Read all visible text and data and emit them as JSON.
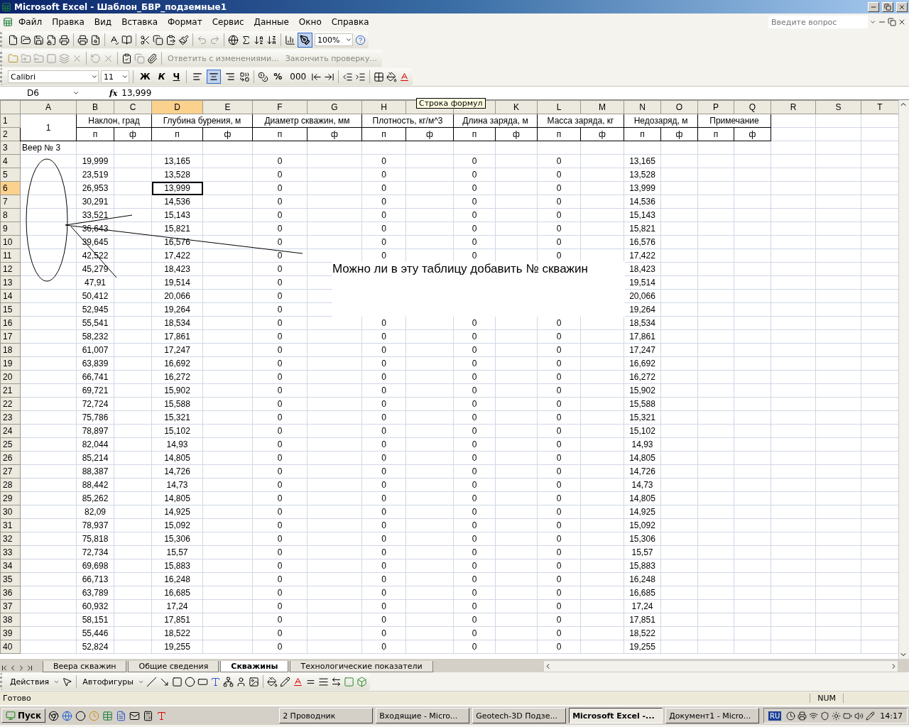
{
  "window": {
    "title": "Microsoft Excel - Шаблон_БВР_подземные1"
  },
  "menu": [
    "Файл",
    "Правка",
    "Вид",
    "Вставка",
    "Формат",
    "Сервис",
    "Данные",
    "Окно",
    "Справка"
  ],
  "help_search": {
    "placeholder": "Введите вопрос"
  },
  "standard_toolbar": {
    "zoom": "100%",
    "drawing_pressed": true
  },
  "review_toolbar": {
    "reply": "Ответить с изменениями...",
    "end_review": "Закончить проверку..."
  },
  "formatting_toolbar": {
    "font": "Calibri",
    "size": "11",
    "bold": "Ж",
    "italic": "К",
    "underline": "Ч",
    "alignment": [
      {
        "selected": false
      },
      {
        "selected": true
      },
      {
        "selected": false
      }
    ],
    "percent": "%",
    "thousands": "000"
  },
  "formula_bar": {
    "name_box": "D6",
    "fx": "fx",
    "value": "13,999"
  },
  "tooltip": "Строка формул",
  "columns": [
    {
      "label": "A",
      "selected": false
    },
    {
      "label": "B",
      "selected": false
    },
    {
      "label": "C",
      "selected": false
    },
    {
      "label": "D",
      "selected": true
    },
    {
      "label": "E",
      "selected": false
    },
    {
      "label": "F",
      "selected": false
    },
    {
      "label": "G",
      "selected": false
    },
    {
      "label": "H",
      "selected": false
    },
    {
      "selected": false
    },
    {
      "selected": false
    },
    {
      "label": "K",
      "selected": false
    },
    {
      "label": "L",
      "selected": false
    },
    {
      "label": "M",
      "selected": false
    },
    {
      "label": "N",
      "selected": false
    },
    {
      "label": "O",
      "selected": false
    },
    {
      "label": "P",
      "selected": false
    },
    {
      "label": "Q",
      "selected": false
    },
    {
      "label": "R",
      "selected": false
    },
    {
      "label": "S",
      "selected": false
    },
    {
      "label": "T",
      "selected": false
    }
  ],
  "header_row1": {
    "num": "1",
    "a": "1",
    "groups": [
      "Наклон, град",
      "Глубина бурения, м",
      "Диаметр скважин, мм",
      "Плотность, кг/м^3",
      "Длина заряда, м",
      "Масса заряда, кг",
      "Недозаряд, м",
      "Примечание"
    ]
  },
  "header_row2": {
    "num": "2",
    "labels": [
      "п",
      "ф",
      "п",
      "ф",
      "п",
      "ф",
      "п",
      "ф",
      "п",
      "ф",
      "п",
      "ф",
      "п",
      "ф",
      "п",
      "ф"
    ]
  },
  "row3": {
    "num": "3",
    "a": "Веер № 3"
  },
  "rows": [
    {
      "num": "4",
      "selected": false,
      "b": "19,999",
      "d": "13,165",
      "f": "0",
      "h": "0",
      "j": "0",
      "l": "0",
      "n": "13,165"
    },
    {
      "num": "5",
      "selected": false,
      "b": "23,519",
      "d": "13,528",
      "f": "0",
      "h": "0",
      "j": "0",
      "l": "0",
      "n": "13,528"
    },
    {
      "num": "6",
      "selected": true,
      "b": "26,953",
      "d": "13,999",
      "f": "0",
      "h": "0",
      "j": "0",
      "l": "0",
      "n": "13,999"
    },
    {
      "num": "7",
      "selected": false,
      "b": "30,291",
      "d": "14,536",
      "f": "0",
      "h": "0",
      "j": "0",
      "l": "0",
      "n": "14,536"
    },
    {
      "num": "8",
      "selected": false,
      "b": "33,521",
      "d": "15,143",
      "f": "0",
      "h": "0",
      "j": "0",
      "l": "0",
      "n": "15,143"
    },
    {
      "num": "9",
      "selected": false,
      "b": "36,643",
      "d": "15,821",
      "f": "0",
      "h": "0",
      "j": "0",
      "l": "0",
      "n": "15,821"
    },
    {
      "num": "10",
      "selected": false,
      "b": "39,645",
      "d": "16,576",
      "f": "0",
      "h": "0",
      "j": "0",
      "l": "0",
      "n": "16,576"
    },
    {
      "num": "11",
      "selected": false,
      "b": "42,522",
      "d": "17,422",
      "f": "0",
      "h": "0",
      "j": "0",
      "l": "0",
      "n": "17,422"
    },
    {
      "num": "12",
      "selected": false,
      "b": "45,279",
      "d": "18,423",
      "f": "0",
      "n": "18,423"
    },
    {
      "num": "13",
      "selected": false,
      "b": "47,91",
      "d": "19,514",
      "f": "0",
      "n": "19,514"
    },
    {
      "num": "14",
      "selected": false,
      "b": "50,412",
      "d": "20,066",
      "f": "0",
      "n": "20,066"
    },
    {
      "num": "15",
      "selected": false,
      "b": "52,945",
      "d": "19,264",
      "f": "0",
      "n": "19,264"
    },
    {
      "num": "16",
      "selected": false,
      "b": "55,541",
      "d": "18,534",
      "f": "0",
      "h": "0",
      "j": "0",
      "l": "0",
      "n": "18,534"
    },
    {
      "num": "17",
      "selected": false,
      "b": "58,232",
      "d": "17,861",
      "f": "0",
      "h": "0",
      "j": "0",
      "l": "0",
      "n": "17,861"
    },
    {
      "num": "18",
      "selected": false,
      "b": "61,007",
      "d": "17,247",
      "f": "0",
      "h": "0",
      "j": "0",
      "l": "0",
      "n": "17,247"
    },
    {
      "num": "19",
      "selected": false,
      "b": "63,839",
      "d": "16,692",
      "f": "0",
      "h": "0",
      "j": "0",
      "l": "0",
      "n": "16,692"
    },
    {
      "num": "20",
      "selected": false,
      "b": "66,741",
      "d": "16,272",
      "f": "0",
      "h": "0",
      "j": "0",
      "l": "0",
      "n": "16,272"
    },
    {
      "num": "21",
      "selected": false,
      "b": "69,721",
      "d": "15,902",
      "f": "0",
      "h": "0",
      "j": "0",
      "l": "0",
      "n": "15,902"
    },
    {
      "num": "22",
      "selected": false,
      "b": "72,724",
      "d": "15,588",
      "f": "0",
      "h": "0",
      "j": "0",
      "l": "0",
      "n": "15,588"
    },
    {
      "num": "23",
      "selected": false,
      "b": "75,786",
      "d": "15,321",
      "f": "0",
      "h": "0",
      "j": "0",
      "l": "0",
      "n": "15,321"
    },
    {
      "num": "24",
      "selected": false,
      "b": "78,897",
      "d": "15,102",
      "f": "0",
      "h": "0",
      "j": "0",
      "l": "0",
      "n": "15,102"
    },
    {
      "num": "25",
      "selected": false,
      "b": "82,044",
      "d": "14,93",
      "f": "0",
      "h": "0",
      "j": "0",
      "l": "0",
      "n": "14,93"
    },
    {
      "num": "26",
      "selected": false,
      "b": "85,214",
      "d": "14,805",
      "f": "0",
      "h": "0",
      "j": "0",
      "l": "0",
      "n": "14,805"
    },
    {
      "num": "27",
      "selected": false,
      "b": "88,387",
      "d": "14,726",
      "f": "0",
      "h": "0",
      "j": "0",
      "l": "0",
      "n": "14,726"
    },
    {
      "num": "28",
      "selected": false,
      "b": "88,442",
      "d": "14,73",
      "f": "0",
      "h": "0",
      "j": "0",
      "l": "0",
      "n": "14,73"
    },
    {
      "num": "29",
      "selected": false,
      "b": "85,262",
      "d": "14,805",
      "f": "0",
      "h": "0",
      "j": "0",
      "l": "0",
      "n": "14,805"
    },
    {
      "num": "30",
      "selected": false,
      "b": "82,09",
      "d": "14,925",
      "f": "0",
      "h": "0",
      "j": "0",
      "l": "0",
      "n": "14,925"
    },
    {
      "num": "31",
      "selected": false,
      "b": "78,937",
      "d": "15,092",
      "f": "0",
      "h": "0",
      "j": "0",
      "l": "0",
      "n": "15,092"
    },
    {
      "num": "32",
      "selected": false,
      "b": "75,818",
      "d": "15,306",
      "f": "0",
      "h": "0",
      "j": "0",
      "l": "0",
      "n": "15,306"
    },
    {
      "num": "33",
      "selected": false,
      "b": "72,734",
      "d": "15,57",
      "f": "0",
      "h": "0",
      "j": "0",
      "l": "0",
      "n": "15,57"
    },
    {
      "num": "34",
      "selected": false,
      "b": "69,698",
      "d": "15,883",
      "f": "0",
      "h": "0",
      "j": "0",
      "l": "0",
      "n": "15,883"
    },
    {
      "num": "35",
      "selected": false,
      "b": "66,713",
      "d": "16,248",
      "f": "0",
      "h": "0",
      "j": "0",
      "l": "0",
      "n": "16,248"
    },
    {
      "num": "36",
      "selected": false,
      "b": "63,789",
      "d": "16,685",
      "f": "0",
      "h": "0",
      "j": "0",
      "l": "0",
      "n": "16,685"
    },
    {
      "num": "37",
      "selected": false,
      "b": "60,932",
      "d": "17,24",
      "f": "0",
      "h": "0",
      "j": "0",
      "l": "0",
      "n": "17,24"
    },
    {
      "num": "38",
      "selected": false,
      "b": "58,151",
      "d": "17,851",
      "f": "0",
      "h": "0",
      "j": "0",
      "l": "0",
      "n": "17,851"
    },
    {
      "num": "39",
      "selected": false,
      "b": "55,446",
      "d": "18,522",
      "f": "0",
      "h": "0",
      "j": "0",
      "l": "0",
      "n": "18,522"
    },
    {
      "num": "40",
      "selected": false,
      "b": "52,824",
      "d": "19,255",
      "f": "0",
      "h": "0",
      "j": "0",
      "l": "0",
      "n": "19,255"
    }
  ],
  "text_box": "Можно ли в эту таблицу добавить № скважин",
  "sheet_tabs": [
    {
      "label": "Веера скважин",
      "selected": false
    },
    {
      "label": "Общие сведения",
      "selected": false
    },
    {
      "label": "Скважины",
      "selected": true
    },
    {
      "label": "Технологические показатели",
      "selected": false
    }
  ],
  "drawing_toolbar": {
    "actions": "Действия",
    "autoshapes": "Автофигуры"
  },
  "status_bar": {
    "status": "Готово",
    "num": "NUM"
  },
  "taskbar": {
    "start": "Пуск",
    "tasks": [
      {
        "label": "2 Проводник",
        "selected": false
      },
      {
        "label": "Входящие - Micro...",
        "selected": false
      },
      {
        "label": "Geotech-3D Подзе...",
        "selected": false
      },
      {
        "label": "Microsoft Excel -...",
        "selected": true
      },
      {
        "label": "Документ1 - Micro...",
        "selected": false
      }
    ],
    "lang": "RU",
    "clock": "14:17"
  }
}
